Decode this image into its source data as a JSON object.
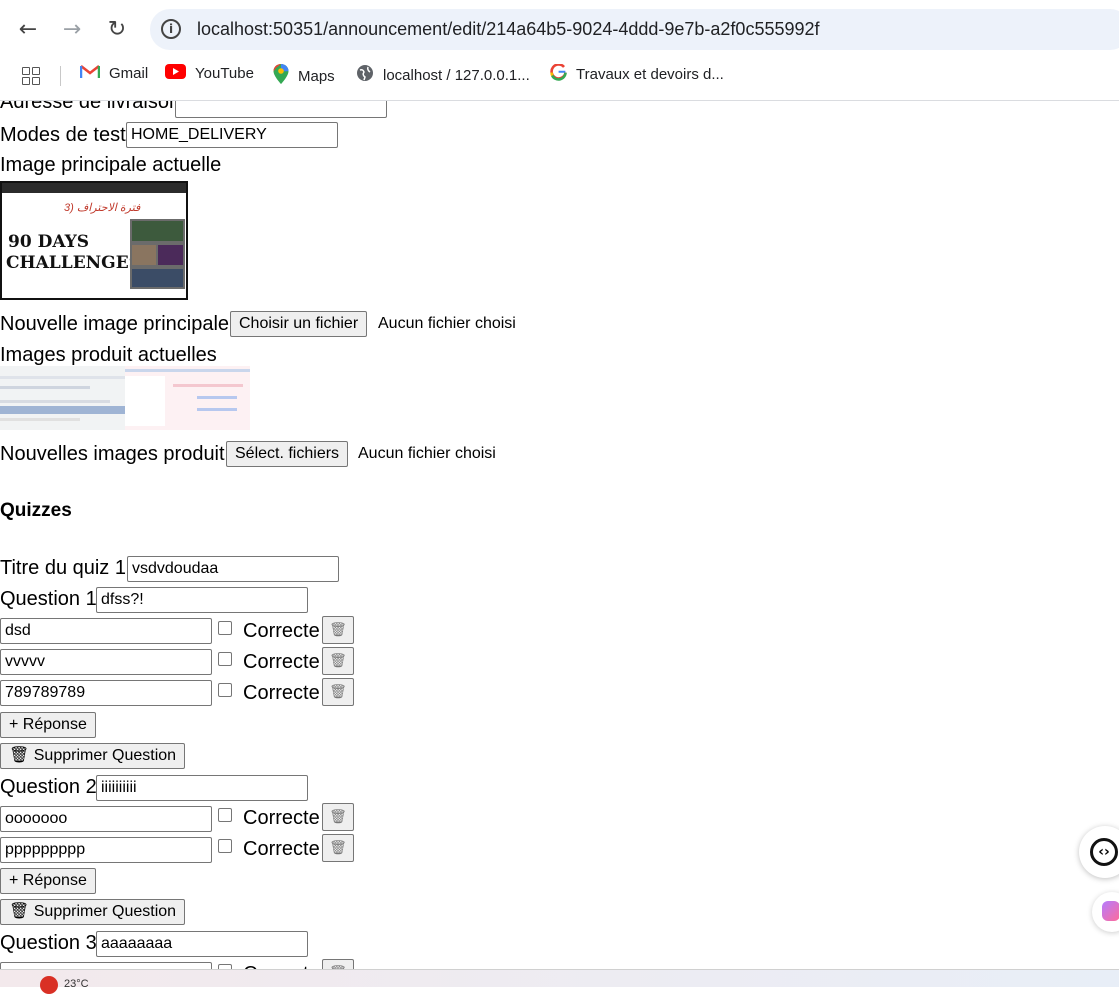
{
  "browser": {
    "url": "localhost:50351/announcement/edit/214a64b5-9024-4ddd-9e7b-a2f0c555992f",
    "bookmarks": [
      {
        "label": "Gmail",
        "icon": "gmail-icon"
      },
      {
        "label": "YouTube",
        "icon": "youtube-icon"
      },
      {
        "label": "Maps",
        "icon": "maps-icon"
      },
      {
        "label": "localhost / 127.0.0.1...",
        "icon": "globe-icon"
      },
      {
        "label": "Travaux et devoirs d...",
        "icon": "google-icon"
      }
    ]
  },
  "form": {
    "delivery_address_label": "Adresse de livraison",
    "delivery_address_value": "",
    "test_modes_label": "Modes de test",
    "test_modes_value": "HOME_DELIVERY",
    "current_main_image_label": "Image principale actuelle",
    "main_image": {
      "arabic_text": "3) فترة الاحتراف",
      "line1": "90 DAYS",
      "line2": "CHALLENGES"
    },
    "new_main_image_label": "Nouvelle image principale",
    "choose_file_button": "Choisir un fichier",
    "no_file_1": "Aucun fichier choisi",
    "current_product_images_label": "Images produit actuelles",
    "new_product_images_label": "Nouvelles images produit",
    "select_files_button": "Sélect. fichiers",
    "no_file_2": "Aucun fichier choisi"
  },
  "quizzes": {
    "heading": "Quizzes",
    "quiz_title_label": "Titre du quiz 1",
    "quiz_title_value": "vsdvdoudaa",
    "correct_label": "Correcte",
    "add_answer_label": "+ Réponse",
    "delete_question_label": "🗑 Supprimer Question",
    "questions": [
      {
        "label": "Question 1",
        "value": "dfss?!",
        "answers": [
          "dsd",
          "vvvvv",
          "789789789"
        ]
      },
      {
        "label": "Question 2",
        "value": "iiiiiiiiii",
        "answers": [
          "ooooooo",
          "ppppppppp"
        ]
      },
      {
        "label": "Question 3",
        "value": "aaaaaaaa",
        "answers": [
          ""
        ]
      }
    ]
  },
  "taskbar": {
    "weather": "23°C"
  }
}
